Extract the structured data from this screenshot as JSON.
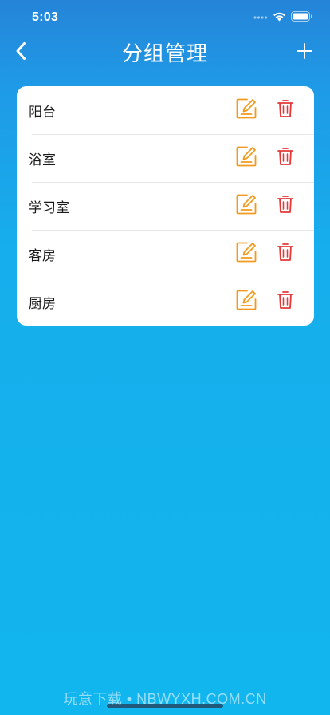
{
  "status_bar": {
    "time": "5:03"
  },
  "nav": {
    "title": "分组管理",
    "back_icon": "chevron-left-icon",
    "add_icon": "plus-icon"
  },
  "groups": {
    "items": [
      {
        "name": "阳台"
      },
      {
        "name": "浴室"
      },
      {
        "name": "学习室"
      },
      {
        "name": "客房"
      },
      {
        "name": "厨房"
      }
    ],
    "edit_icon": "edit-icon",
    "delete_icon": "trash-icon"
  },
  "colors": {
    "edit": "#f39a1e",
    "delete": "#e23a3a",
    "background_top": "#2584d8",
    "background_bottom": "#12b6ee"
  },
  "watermark": {
    "text": "玩意下载 • NBWYXH.COM.CN"
  }
}
